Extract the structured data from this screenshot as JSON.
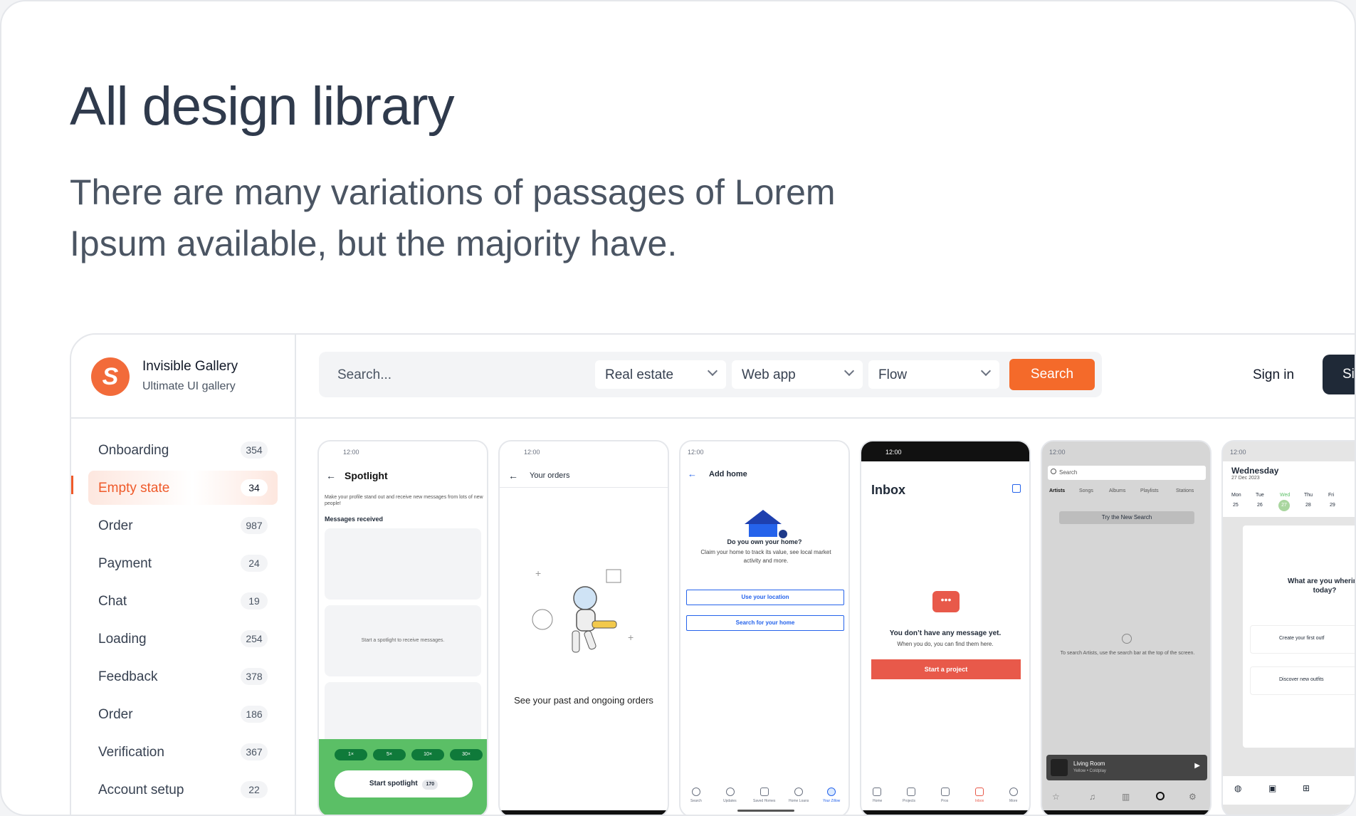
{
  "hero": {
    "title": "All design library",
    "subtitle": "There are many variations of passages of Lorem Ipsum available, but the majority have."
  },
  "brand": {
    "logo_glyph": "S",
    "name": "Invisible Gallery",
    "tagline": "Ultimate UI gallery"
  },
  "search": {
    "placeholder": "Search...",
    "filters": [
      "Real estate",
      "Web app",
      "Flow"
    ],
    "button": "Search"
  },
  "auth": {
    "signin": "Sign in",
    "signup": "Si"
  },
  "sidebar": {
    "items": [
      {
        "label": "Onboarding",
        "count": "354"
      },
      {
        "label": "Empty state",
        "count": "34"
      },
      {
        "label": "Order",
        "count": "987"
      },
      {
        "label": "Payment",
        "count": "24"
      },
      {
        "label": "Chat",
        "count": "19"
      },
      {
        "label": "Loading",
        "count": "254"
      },
      {
        "label": "Feedback",
        "count": "378"
      },
      {
        "label": "Order",
        "count": "186"
      },
      {
        "label": "Verification",
        "count": "367"
      },
      {
        "label": "Account setup",
        "count": "22"
      }
    ],
    "active_index": 1
  },
  "colors": {
    "accent": "#f46a2a",
    "green": "#5bbf66",
    "red": "#e8594a",
    "dark": "#1f2937"
  },
  "screens": {
    "spotlight": {
      "time": "12:00",
      "title": "Spotlight",
      "desc": "Make your profile stand out and receive new messages from lots of new people!",
      "section": "Messages received",
      "empty_msg": "Start a spotlight to receive messages.",
      "chips": [
        "1×",
        "5×",
        "10×",
        "30×"
      ],
      "cta": "Start spotlight",
      "cta_count": "170"
    },
    "orders": {
      "time": "12:00",
      "title": "Your orders",
      "caption": "See your past and ongoing orders"
    },
    "add_home": {
      "time": "12:00",
      "title": "Add home",
      "question": "Do you own your home?",
      "desc": "Claim your home to track its value, see local market activity and more.",
      "btn1": "Use your location",
      "btn2": "Search for your home",
      "tabs": [
        "Search",
        "Updates",
        "Saved Homes",
        "Home Loans",
        "Your Zillow"
      ]
    },
    "inbox": {
      "time": "12:00",
      "title": "Inbox",
      "empty_title": "You don’t have any message yet.",
      "empty_desc": "When you do, you can find them here.",
      "cta": "Start a project",
      "tabs": [
        "Home",
        "Projects",
        "Pros",
        "Inbox",
        "More"
      ]
    },
    "music": {
      "time": "12:00",
      "search": "Search",
      "tabs": [
        "Artists",
        "Songs",
        "Albums",
        "Playlists",
        "Stations"
      ],
      "try_btn": "Try the New Search",
      "hint": "To search Artists, use the search bar at the top of the screen.",
      "now_playing_title": "Living Room",
      "now_playing_sub": "Yellow • Coldplay"
    },
    "calendar": {
      "time": "12:00",
      "day": "Wednesday",
      "date": "27 Dec 2023",
      "week_days": [
        "Mon",
        "Tue",
        "Wed",
        "Thu",
        "Fri"
      ],
      "week_nums": [
        "25",
        "26",
        "27",
        "28",
        "29"
      ],
      "question": "What are you whering today?",
      "opt1": "Create your first outf",
      "opt2": "Discover new outfits"
    }
  }
}
